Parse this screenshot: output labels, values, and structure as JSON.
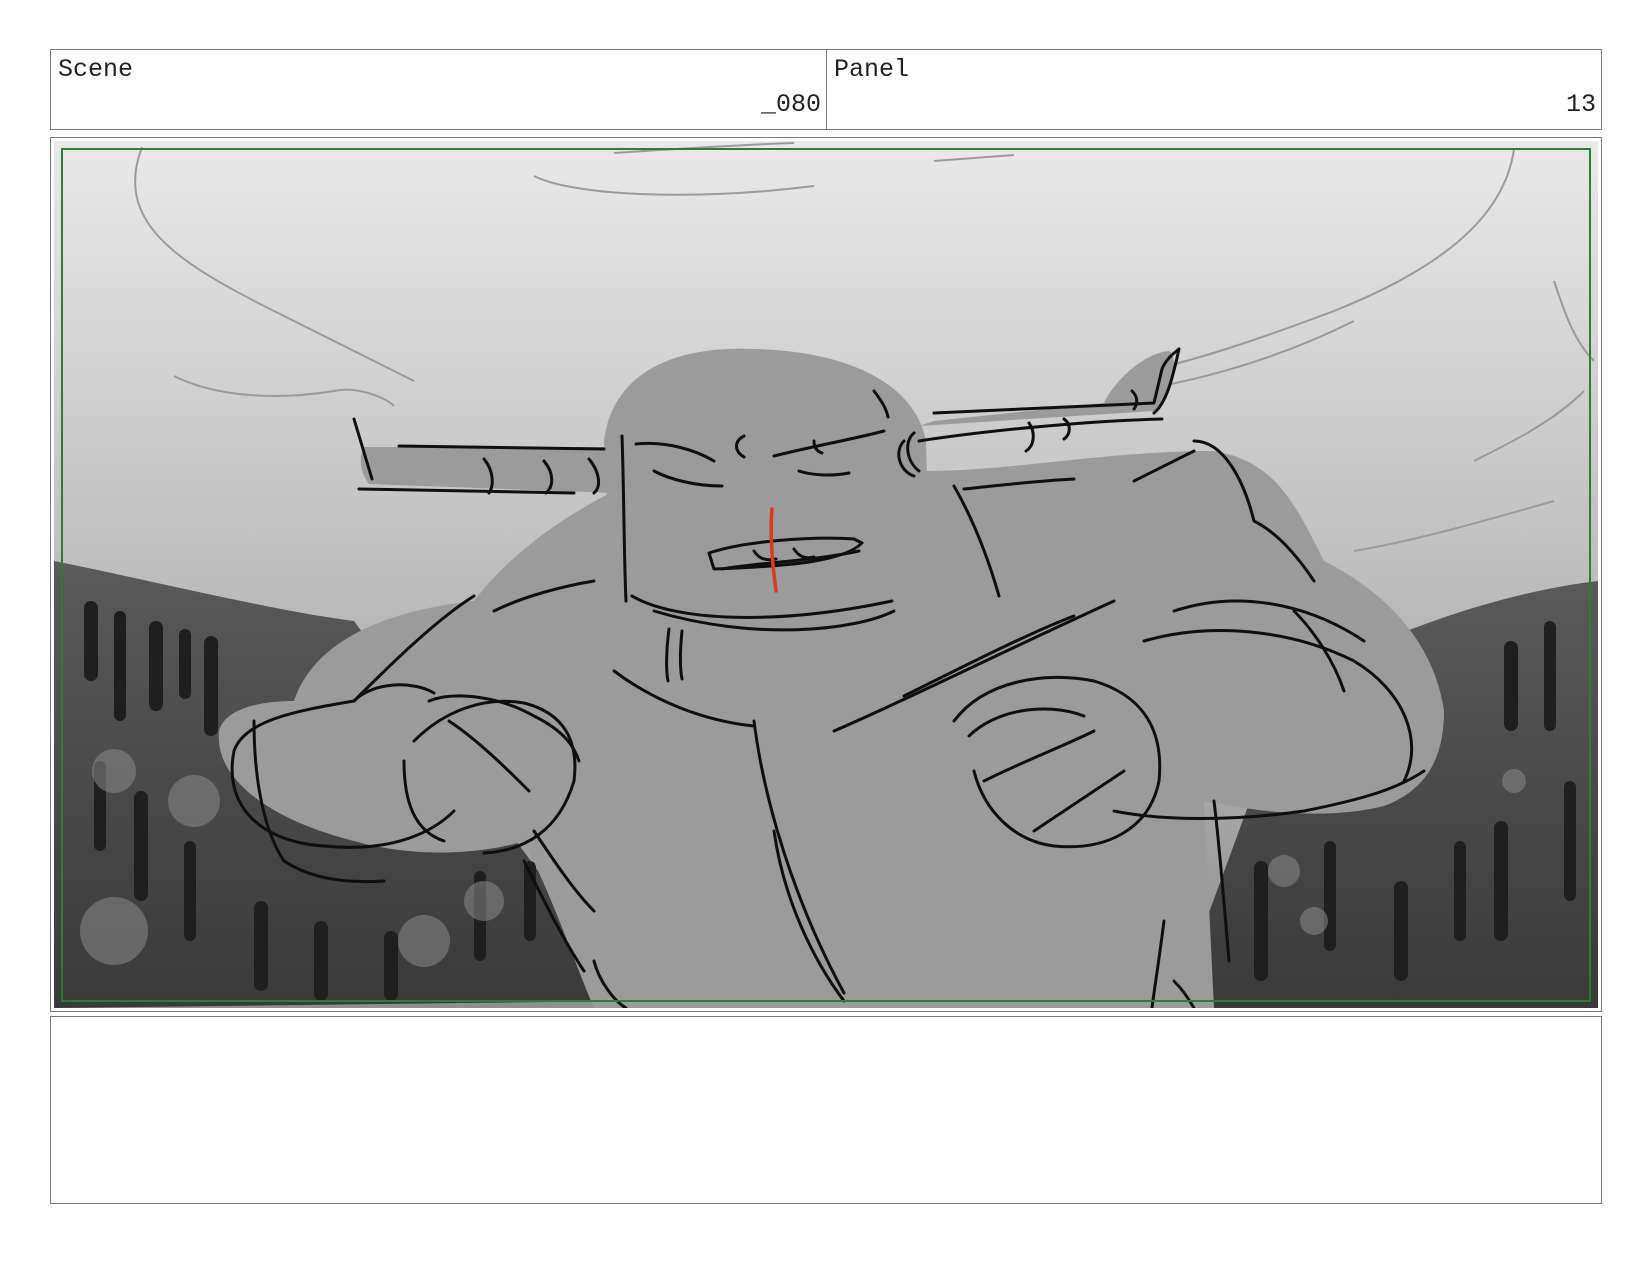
{
  "header": {
    "scene_label": "Scene",
    "scene_value": "_080",
    "panel_label": "Panel",
    "panel_value": "13"
  },
  "panel": {
    "safe_frame_color": "#2e7d32",
    "blood_color": "#d83a1a",
    "figure_fill": "#9b9b9b"
  },
  "notes": {
    "text": ""
  }
}
